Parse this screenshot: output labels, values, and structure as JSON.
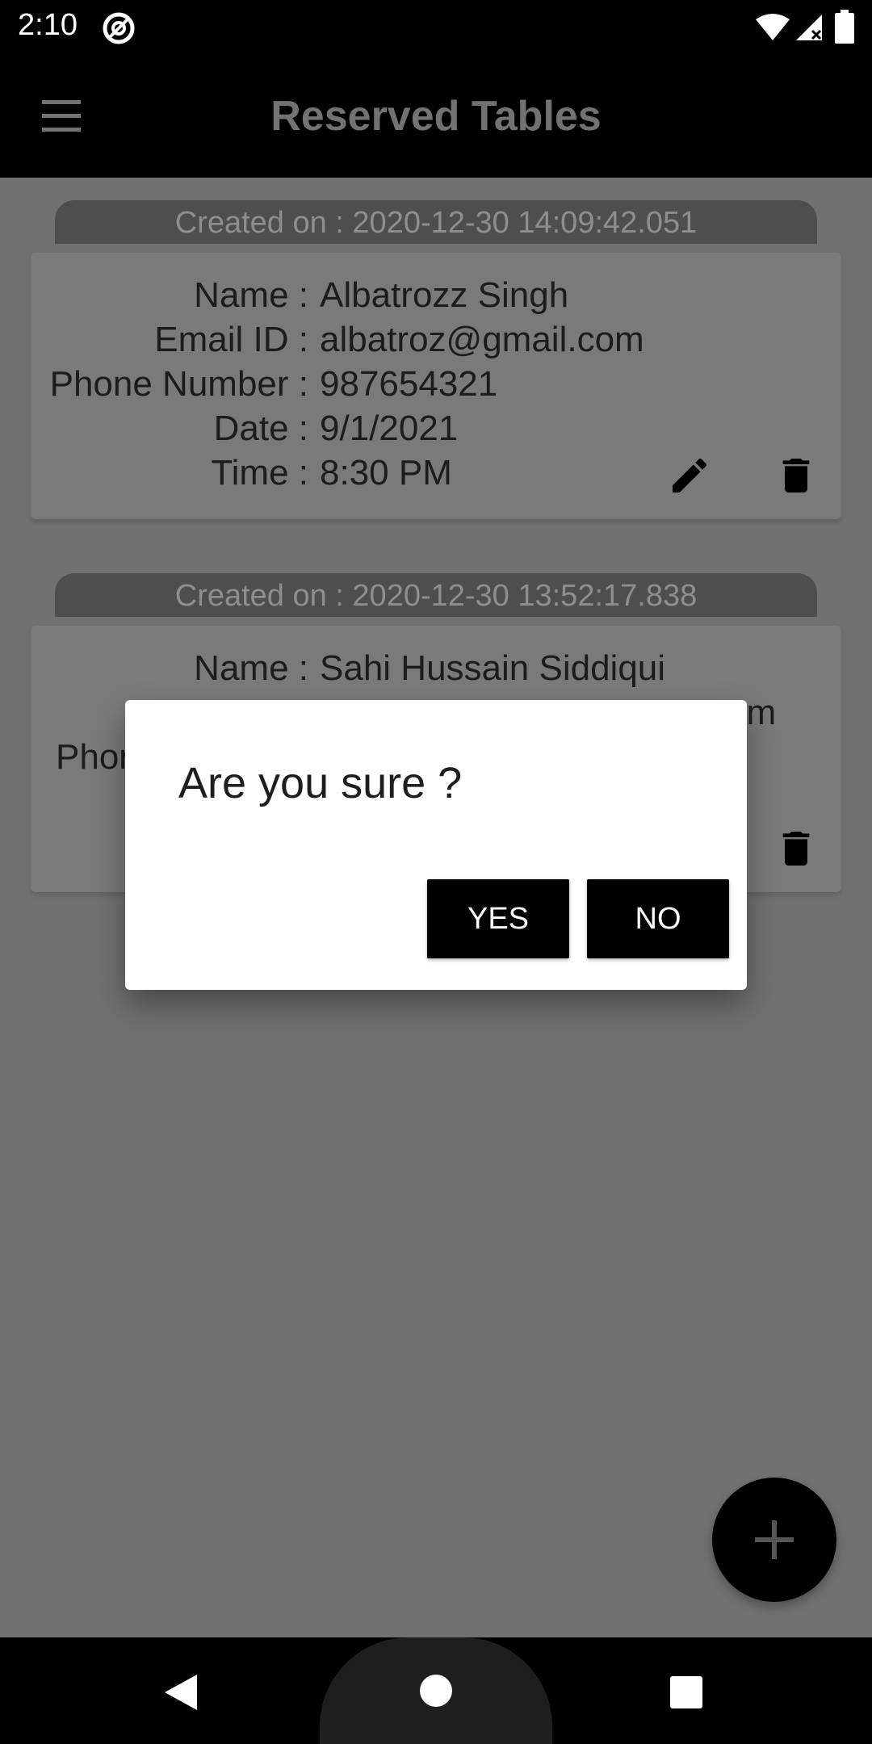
{
  "status_bar": {
    "time": "2:10",
    "icons": [
      "at-sign-icon",
      "wifi-icon",
      "signal-icon",
      "battery-icon"
    ]
  },
  "app_bar": {
    "title": "Reserved Tables",
    "menu_icon": "hamburger-menu-icon"
  },
  "reservations": [
    {
      "created_on": "Created on : 2020-12-30 14:09:42.051",
      "fields": [
        {
          "label": "Name :",
          "value": "Albatrozz Singh"
        },
        {
          "label": "Email ID :",
          "value": "albatroz@gmail.com"
        },
        {
          "label": "Phone Number :",
          "value": "987654321"
        },
        {
          "label": "Date :",
          "value": "9/1/2021"
        },
        {
          "label": "Time :",
          "value": "8:30 PM"
        }
      ]
    },
    {
      "created_on": "Created on : 2020-12-30 13:52:17.838",
      "fields": [
        {
          "label": "Name :",
          "value": "Sahi Hussain Siddiqui"
        },
        {
          "label": "",
          "value": "om"
        },
        {
          "label": "Phor",
          "value": ""
        }
      ]
    }
  ],
  "dialog": {
    "title": "Are you sure ?",
    "yes_label": "YES",
    "no_label": "NO"
  },
  "fab": {
    "icon": "plus-icon"
  },
  "colors": {
    "scrim_background": "#717171",
    "card": "#7a7a7a",
    "created_tab": "#4e4e4e",
    "bars": "#000000",
    "dialog": "#ffffff"
  }
}
